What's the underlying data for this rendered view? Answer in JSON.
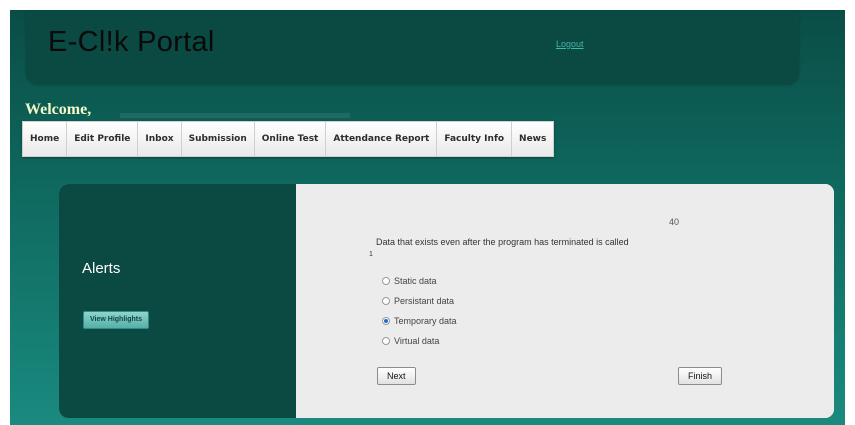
{
  "header": {
    "title": "E-Cl!k Portal",
    "logout_label": "Logout"
  },
  "welcome": {
    "text": "Welcome,"
  },
  "nav": {
    "items": [
      {
        "label": "Home"
      },
      {
        "label": "Edit Profile"
      },
      {
        "label": "Inbox"
      },
      {
        "label": "Submission"
      },
      {
        "label": "Online Test"
      },
      {
        "label": "Attendance Report"
      },
      {
        "label": "Faculty Info"
      },
      {
        "label": "News"
      }
    ]
  },
  "sidebar": {
    "alerts_title": "Alerts",
    "highlights_button": "View Highlights"
  },
  "quiz": {
    "timer": "40",
    "question_number": "1",
    "question_text": "Data that exists even after the program has terminated is called",
    "options": [
      {
        "label": "Static data",
        "selected": false
      },
      {
        "label": "Persistant data",
        "selected": false
      },
      {
        "label": "Temporary data",
        "selected": true
      },
      {
        "label": "Virtual data",
        "selected": false
      }
    ],
    "next_label": "Next",
    "finish_label": "Finish"
  },
  "colors": {
    "header_bg": "#0b4a42",
    "page_gradient_top": "#0a4d46",
    "page_gradient_bottom": "#1a8a7f",
    "welcome_text": "#f3f9c8",
    "logout_link": "#3fb6a6",
    "radio_selected": "#1f6fc2"
  }
}
